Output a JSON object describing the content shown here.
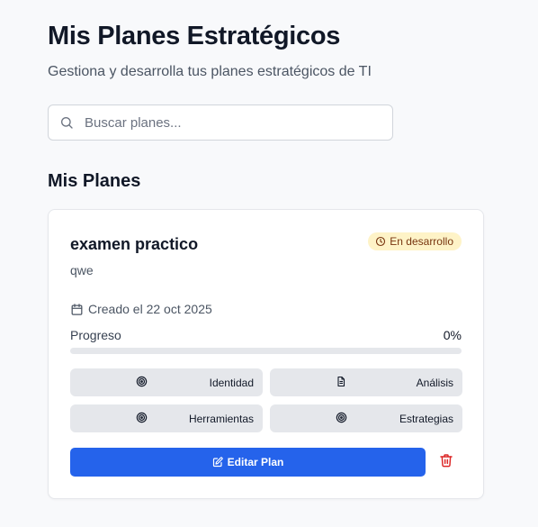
{
  "header": {
    "title": "Mis Planes Estratégicos",
    "subtitle": "Gestiona y desarrolla tus planes estratégicos de TI"
  },
  "search": {
    "icon": "search-icon",
    "placeholder": "Buscar planes...",
    "value": ""
  },
  "section": {
    "title": "Mis Planes"
  },
  "plans": [
    {
      "name": "examen practico",
      "description": "qwe",
      "status": {
        "label": "En desarrollo",
        "icon": "clock-icon",
        "bg": "#fef3c7",
        "fg": "#78350f"
      },
      "created": {
        "icon": "calendar-icon",
        "label": "Creado el 22 oct 2025"
      },
      "progress": {
        "label": "Progreso",
        "value_text": "0%",
        "value": 0
      },
      "modules": [
        {
          "label": "Identidad",
          "icon": "target-icon"
        },
        {
          "label": "Análisis",
          "icon": "document-icon"
        },
        {
          "label": "Herramientas",
          "icon": "target-icon"
        },
        {
          "label": "Estrategias",
          "icon": "target-icon"
        }
      ],
      "actions": {
        "edit_label": "Editar Plan",
        "edit_icon": "edit-icon",
        "delete_icon": "trash-icon"
      }
    }
  ],
  "colors": {
    "accent": "#2563eb",
    "danger": "#dc2626",
    "module_bg": "#e5e7eb"
  }
}
